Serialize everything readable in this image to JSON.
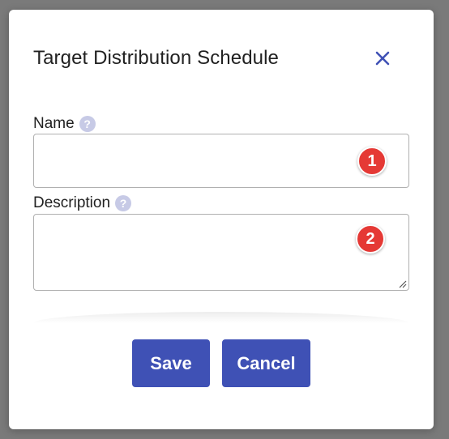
{
  "dialog": {
    "title": "Target Distribution Schedule",
    "close_icon": "close-icon"
  },
  "form": {
    "name": {
      "label": "Name",
      "help_icon": "question-circle-icon",
      "help_glyph": "?",
      "value": "",
      "badge": "1"
    },
    "description": {
      "label": "Description",
      "help_icon": "question-circle-icon",
      "help_glyph": "?",
      "value": "",
      "badge": "2"
    }
  },
  "actions": {
    "save_label": "Save",
    "cancel_label": "Cancel"
  },
  "colors": {
    "primary": "#3f51b5",
    "badge": "#e53935",
    "help_icon": "#c7cae6",
    "overlay": "#7a7a7a"
  }
}
